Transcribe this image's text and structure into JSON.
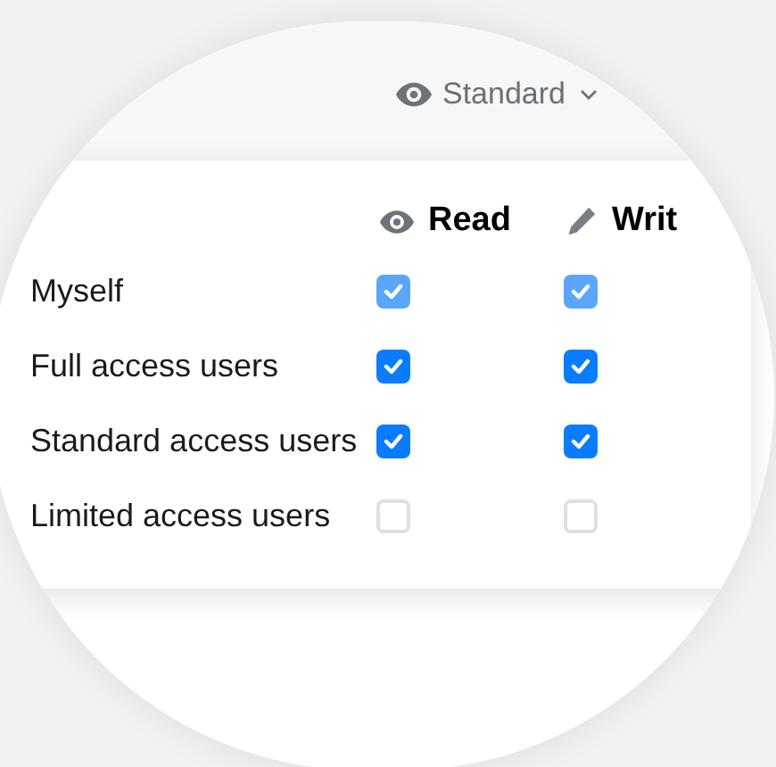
{
  "access_level": {
    "label": "Standard"
  },
  "columns": [
    {
      "kind": "read",
      "label": "Read"
    },
    {
      "kind": "write",
      "label": "Writ"
    }
  ],
  "rows": [
    {
      "label": "Myself",
      "permissions": [
        {
          "checked": true,
          "disabled": true
        },
        {
          "checked": true,
          "disabled": true
        }
      ]
    },
    {
      "label": "Full access users",
      "permissions": [
        {
          "checked": true,
          "disabled": false
        },
        {
          "checked": true,
          "disabled": false
        }
      ]
    },
    {
      "label": "Standard access users",
      "permissions": [
        {
          "checked": true,
          "disabled": false
        },
        {
          "checked": true,
          "disabled": false
        }
      ]
    },
    {
      "label": "Limited access users",
      "permissions": [
        {
          "checked": false,
          "disabled": false
        },
        {
          "checked": false,
          "disabled": false
        }
      ]
    }
  ]
}
